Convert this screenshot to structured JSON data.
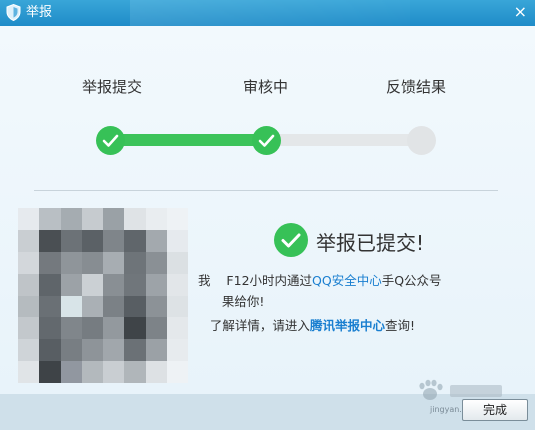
{
  "window": {
    "title": "举报",
    "close_symbol": "×"
  },
  "steps": [
    {
      "label": "举报提交",
      "state": "done"
    },
    {
      "label": "审核中",
      "state": "done"
    },
    {
      "label": "反馈结果",
      "state": "pending"
    }
  ],
  "colors": {
    "success": "#37c157",
    "pending": "#e1e4e6",
    "link": "#1a7fd0",
    "titlebar": "#1f8cc8"
  },
  "result": {
    "title": "举报已提交!",
    "line1_before": "我",
    "line1_mid": "F12小时内通过",
    "line1_link": "QQ安全中心",
    "line1_after": "手Q公众号",
    "line2": "果给你!",
    "line3_before": "了解详情，请进入",
    "line3_link": "腾讯举报中心",
    "line3_after": "查询!"
  },
  "watermark": {
    "text": "jingyan.baidu.com"
  },
  "footer": {
    "done_label": "完成"
  }
}
